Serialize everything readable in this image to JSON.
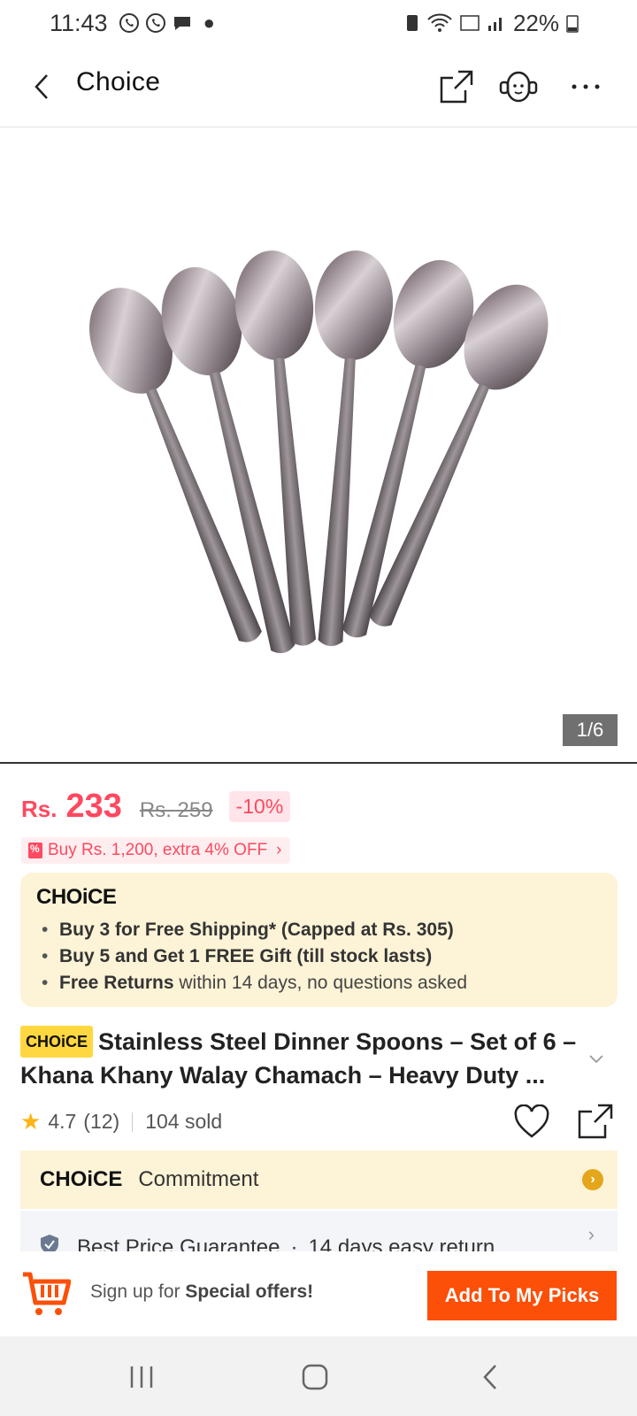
{
  "status_bar": {
    "time": "11:43",
    "battery": "22%"
  },
  "header": {
    "title": "Choice"
  },
  "gallery": {
    "counter": "1/6"
  },
  "price": {
    "currency": "Rs.",
    "value": "233",
    "original": "Rs. 259",
    "discount": "-10%"
  },
  "promo": {
    "label": "Buy Rs. 1,200, extra 4% OFF"
  },
  "choice_box": {
    "logo": "CHOiCE",
    "items": [
      {
        "bold": "Buy 3 for  Free Shipping* (Capped at Rs. 305)",
        "rest": ""
      },
      {
        "bold": "Buy 5 and Get 1 FREE Gift (till stock lasts)",
        "rest": ""
      },
      {
        "bold": "Free Returns",
        "rest": " within 14 days, no questions asked"
      }
    ]
  },
  "product": {
    "tag": "CHOiCE",
    "title": "Stainless Steel Dinner Spoons – Set of 6 – Khana Khany Walay Chamach – Heavy Duty ...",
    "rating": "4.7",
    "reviews": "(12)",
    "sold": "104 sold"
  },
  "commitment": {
    "logo": "CHOiCE",
    "label": "Commitment"
  },
  "guarantee": {
    "item1": "Best Price Guarantee",
    "sep": "·",
    "item2": "14 days easy return"
  },
  "action_bar": {
    "signup_prefix": "Sign up for ",
    "signup_bold": "Special offers!",
    "picks_button": "Add To My Picks"
  },
  "colors": {
    "brand_orange": "#fc4f08",
    "price_red": "#fe4960",
    "choice_yellow": "#fdf3d6",
    "star": "#fcb514"
  }
}
